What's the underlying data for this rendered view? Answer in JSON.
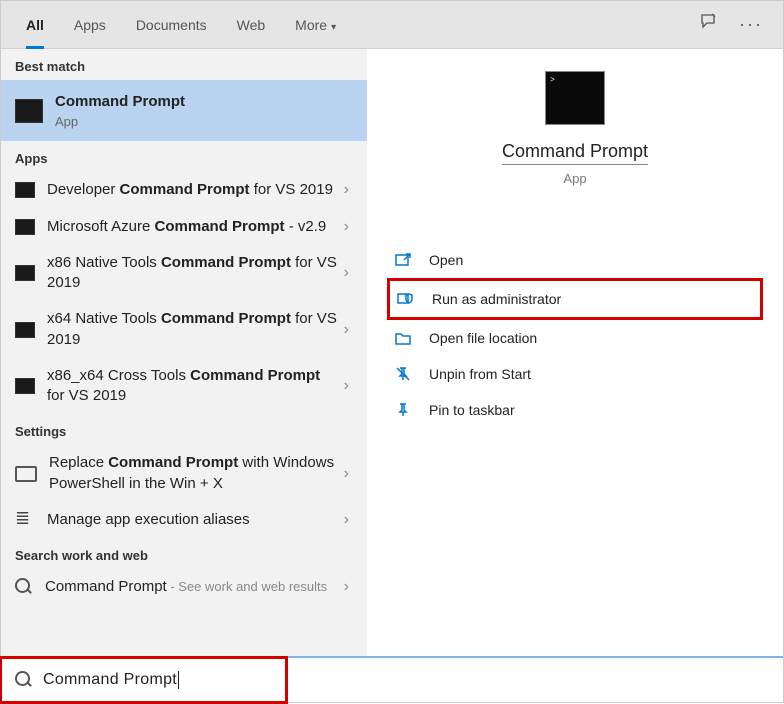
{
  "tabs": {
    "all": "All",
    "apps": "Apps",
    "documents": "Documents",
    "web": "Web",
    "more": "More"
  },
  "sections": {
    "best": "Best match",
    "apps": "Apps",
    "settings": "Settings",
    "workweb": "Search work and web"
  },
  "bestMatch": {
    "title": "Command Prompt",
    "sub": "App"
  },
  "appsResults": [
    {
      "pre": "Developer ",
      "match": "Command Prompt",
      "post": " for VS 2019"
    },
    {
      "pre": "Microsoft Azure ",
      "match": "Command Prompt",
      "post": " - v2.9"
    },
    {
      "pre": "x86 Native Tools ",
      "match": "Command Prompt",
      "post": " for VS 2019"
    },
    {
      "pre": "x64 Native Tools ",
      "match": "Command Prompt",
      "post": " for VS 2019"
    },
    {
      "pre": "x86_x64 Cross Tools ",
      "match": "Command Prompt",
      "post": " for VS 2019"
    }
  ],
  "settingsResults": [
    {
      "pre": "Replace ",
      "match": "Command Prompt",
      "post": " with Windows PowerShell in the Win + X"
    },
    {
      "pre": "Manage app execution aliases",
      "match": "",
      "post": ""
    }
  ],
  "workWeb": {
    "text": "Command Prompt",
    "hint": " - See work and web results"
  },
  "preview": {
    "name": "Command Prompt",
    "type": "App"
  },
  "actions": {
    "open": "Open",
    "runAdmin": "Run as administrator",
    "openLoc": "Open file location",
    "unpin": "Unpin from Start",
    "pinTask": "Pin to taskbar"
  },
  "searchQuery": "Command Prompt"
}
